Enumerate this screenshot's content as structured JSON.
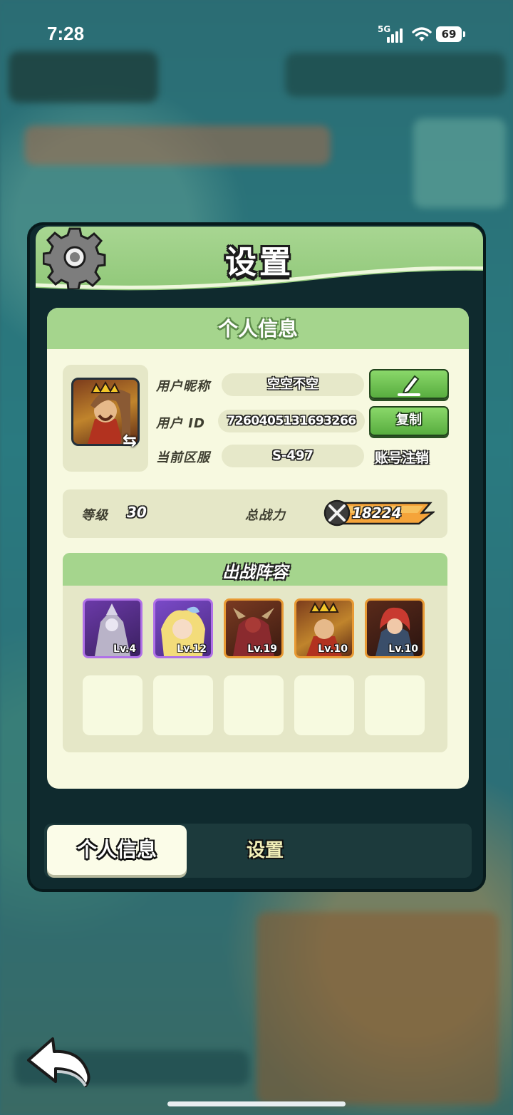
{
  "status_bar": {
    "time": "7:28",
    "network": "5G",
    "battery": "69"
  },
  "header": {
    "title": "设置"
  },
  "card": {
    "title": "个人信息"
  },
  "profile": {
    "nickname_label": "用户昵称",
    "nickname_value": "空空不空",
    "id_label": "用户 ID",
    "id_value": "7260405131693266",
    "copy_label": "复制",
    "server_label": "当前区服",
    "server_value": "S-497",
    "cancel_account_label": "账号注销"
  },
  "stats": {
    "level_label": "等级",
    "level_value": "30",
    "power_label": "总战力",
    "power_value": "18224"
  },
  "lineup": {
    "title": "出战阵容",
    "heroes": [
      {
        "level": "Lv.4",
        "frame": "#9a5ad8"
      },
      {
        "level": "Lv.12",
        "frame": "#9a5ad8"
      },
      {
        "level": "Lv.19",
        "frame": "#e0962e"
      },
      {
        "level": "Lv.10",
        "frame": "#e0962e"
      },
      {
        "level": "Lv.10",
        "frame": "#e0962e"
      }
    ]
  },
  "tabs": [
    {
      "label": "个人信息",
      "active": true
    },
    {
      "label": "设置",
      "active": false
    }
  ],
  "icons": {
    "gear": "gear-icon",
    "edit": "pencil-icon",
    "swap": "swap-icon",
    "power": "swords-icon",
    "back": "back-arrow-icon"
  }
}
